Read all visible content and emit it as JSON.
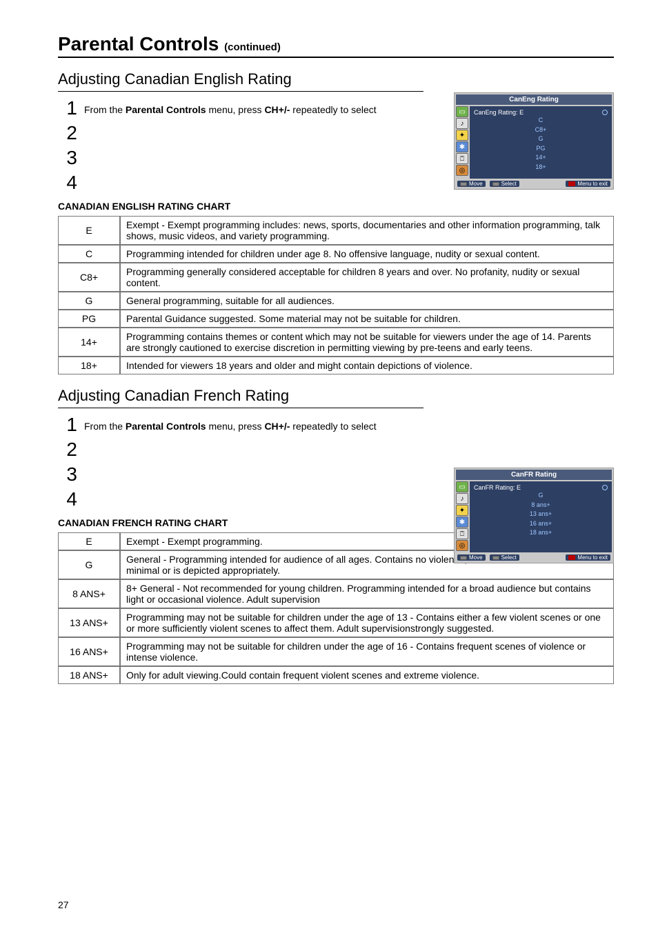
{
  "page_number": "27",
  "title_main": "Parental Controls",
  "title_cont": "(continued)",
  "eng": {
    "subhead": "Adjusting Canadian English Rating",
    "step_intro_prefix": "From the ",
    "step_intro_bold1": "Parental Controls",
    "step_intro_mid": " menu, press ",
    "step_intro_bold2": "CH+/-",
    "step_intro_suffix": " repeatedly to select",
    "chart_title": "CANADIAN ENGLISH RATING CHART",
    "table": [
      {
        "code": "E",
        "desc": "Exempt - Exempt programming includes: news, sports, documentaries and other information programming, talk shows, music videos, and variety programming."
      },
      {
        "code": "C",
        "desc": "Programming intended for children under age 8. No offensive language, nudity or sexual content."
      },
      {
        "code": "C8+",
        "desc": "Programming generally considered acceptable for children 8 years and over. No profanity, nudity or sexual content."
      },
      {
        "code": "G",
        "desc": "General programming, suitable for all audiences."
      },
      {
        "code": "PG",
        "desc": "Parental Guidance suggested. Some material may not be suitable for children."
      },
      {
        "code": "14+",
        "desc": "Programming contains themes or content which may not be suitable for viewers under the age of 14. Parents are strongly cautioned to exercise discretion in permitting viewing by pre-teens and early teens."
      },
      {
        "code": "18+",
        "desc": "Intended for viewers 18 years and older and might contain depictions of violence."
      }
    ],
    "osd": {
      "title": "CanEng Rating",
      "label": "CanEng Rating:",
      "value": "E",
      "options": [
        "C",
        "C8+",
        "G",
        "PG",
        "14+",
        "18+"
      ],
      "footer_move": "Move",
      "footer_select": "Select",
      "footer_menu": "Menu to exit"
    }
  },
  "fr": {
    "subhead": "Adjusting Canadian French Rating",
    "step_intro_prefix": "From the ",
    "step_intro_bold1": "Parental Controls",
    "step_intro_mid": " menu, press ",
    "step_intro_bold2": "CH+/-",
    "step_intro_suffix": " repeatedly to select",
    "chart_title": "CANADIAN FRENCH RATING CHART",
    "table": [
      {
        "code": "E",
        "desc": "Exempt - Exempt programming."
      },
      {
        "code": "G",
        "desc": "General - Programming intended for audience of all ages. Contains no violence, or the violence content is minimal or is depicted appropriately."
      },
      {
        "code": "8 ANS+",
        "desc": "8+ General - Not recommended for young children. Programming intended for a broad audience but contains light or occasional violence. Adult supervision"
      },
      {
        "code": "13 ANS+",
        "desc": "Programming may not be suitable for children under the age of 13 - Contains either a few violent scenes or one or more sufficiently violent scenes to affect them. Adult supervisionstrongly suggested."
      },
      {
        "code": "16 ANS+",
        "desc": "Programming may not be suitable for children under the age of 16 - Contains frequent scenes of violence or intense violence."
      },
      {
        "code": "18 ANS+",
        "desc": "Only for adult viewing.Could contain frequent violent scenes and extreme violence."
      }
    ],
    "osd": {
      "title": "CanFR Rating",
      "label": "CanFR Rating:",
      "value": "E",
      "options": [
        "G",
        "8 ans+",
        "13 ans+",
        "16 ans+",
        "18 ans+"
      ],
      "footer_move": "Move",
      "footer_select": "Select",
      "footer_menu": "Menu to exit"
    }
  },
  "steps_numbers": [
    "1",
    "2",
    "3",
    "4"
  ],
  "icons": {
    "pic": "▭",
    "sound": "♪",
    "sig": "✦",
    "func": "✱",
    "lock": "⍞",
    "setup": "◎"
  }
}
